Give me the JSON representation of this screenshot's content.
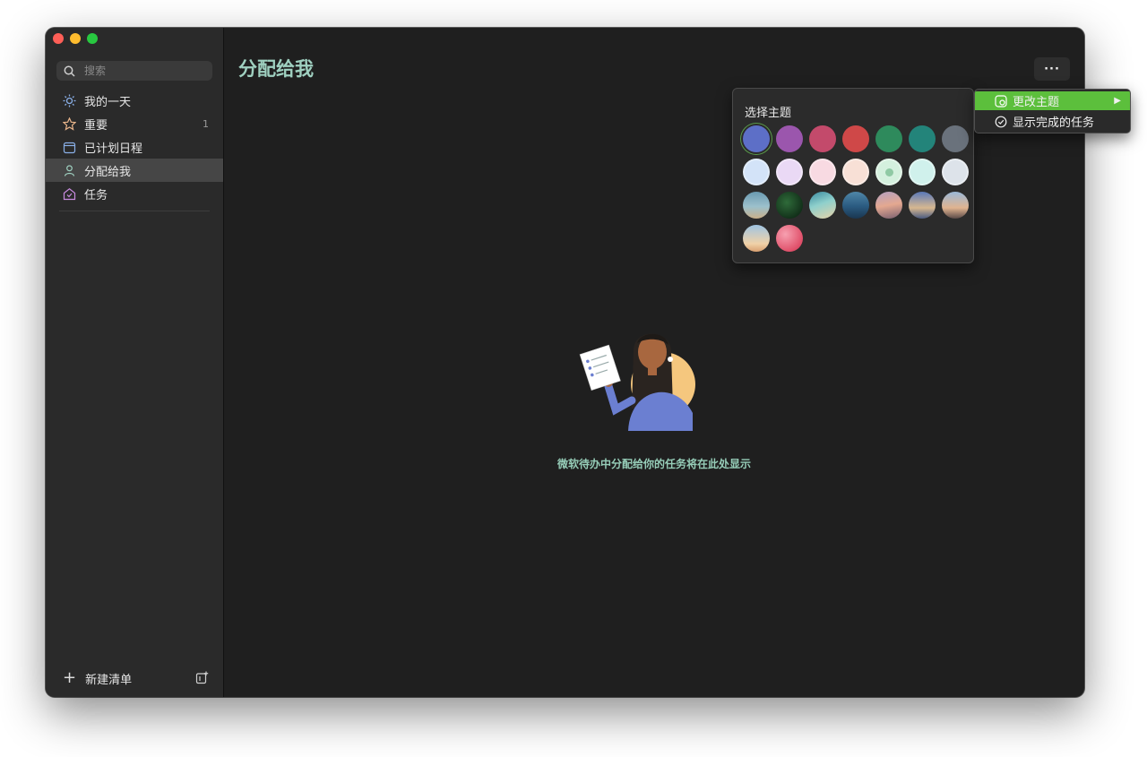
{
  "sidebar": {
    "search_placeholder": "搜索",
    "items": [
      {
        "label": "我的一天",
        "icon": "sun-icon",
        "count": ""
      },
      {
        "label": "重要",
        "icon": "star-icon",
        "count": "1"
      },
      {
        "label": "已计划日程",
        "icon": "calendar-icon",
        "count": ""
      },
      {
        "label": "分配给我",
        "icon": "person-icon",
        "count": ""
      },
      {
        "label": "任务",
        "icon": "home-icon",
        "count": ""
      }
    ],
    "new_list_label": "新建清单"
  },
  "main": {
    "title": "分配给我",
    "more_label": "···",
    "empty_text": "微软待办中分配给你的任务将在此处显示"
  },
  "theme_picker": {
    "title": "选择主题",
    "rows": [
      [
        "#5d6fc7",
        "#9b56ad",
        "#c34a6b",
        "#cf4848",
        "#2e8a5c",
        "#23847a",
        "#6a727c"
      ],
      [
        "#d3e3f8",
        "#ead9f5",
        "#f8dae2",
        "#f8e0d6",
        "#d4f0de",
        "#d0f1ec",
        "#dde3ea"
      ],
      [
        "image-lighthouse",
        "image-palm-leaves",
        "image-beach",
        "image-sea",
        "image-sunset",
        "image-lake",
        "image-pier"
      ],
      [
        "image-umbrella",
        "image-pink-abstract"
      ]
    ],
    "selected": "#5d6fc7"
  },
  "context_menu": {
    "items": [
      {
        "label": "更改主题",
        "icon": "theme-icon",
        "has_submenu": true
      },
      {
        "label": "显示完成的任务",
        "icon": "check-circle-icon",
        "has_submenu": false
      }
    ],
    "highlight_color": "#5cbf3c"
  },
  "colors": {
    "accent": "#9fd0c0",
    "sidebar_bg": "#2a2a2a",
    "main_bg": "#1f1f1f"
  }
}
